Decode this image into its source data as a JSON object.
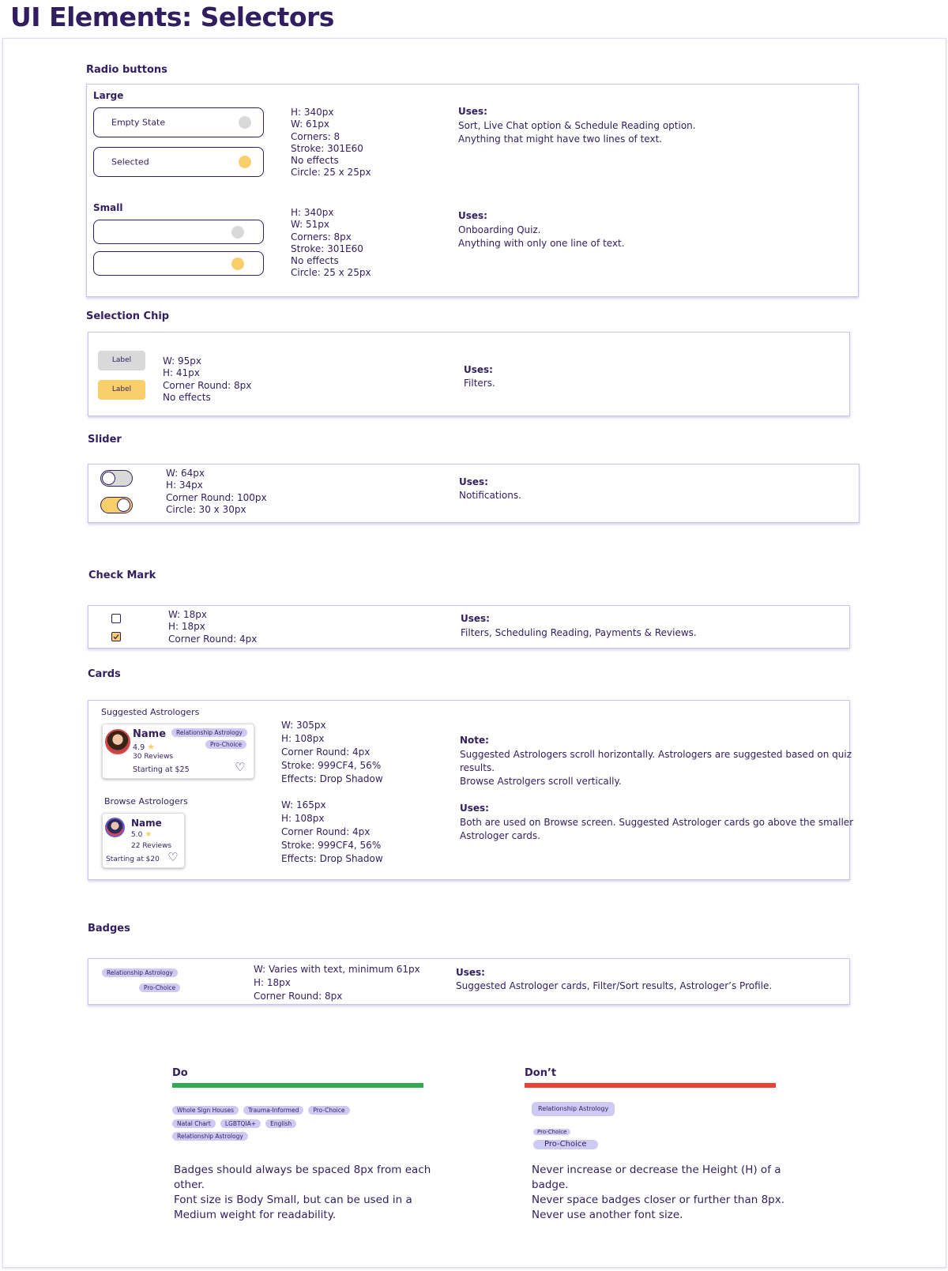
{
  "page": {
    "title": "UI Elements: Selectors"
  },
  "colors": {
    "primary": "#301E60",
    "accent": "#F9CF6B",
    "empty": "#D9D9D9",
    "stroke": "#999CF4",
    "badge": "#CFCAF4",
    "do": "#34A853",
    "dont": "#EA4335"
  },
  "radio": {
    "title": "Radio buttons",
    "large": {
      "label": "Large",
      "empty_label": "Empty State",
      "selected_label": "Selected",
      "specs": "H: 340px\nW: 61px\nCorners: 8\nStroke: 301E60\nNo effects\nCircle: 25 x 25px",
      "uses_title": "Uses:",
      "uses": "Sort, Live Chat option & Schedule Reading option.\nAnything that might have two lines of text."
    },
    "small": {
      "label": "Small",
      "specs": "H: 340px\nW: 51px\nCorners: 8px\nStroke: 301E60\nNo effects\nCircle: 25 x 25px",
      "uses_title": "Uses:",
      "uses": "Onboarding Quiz.\nAnything with only one line of text."
    }
  },
  "chip": {
    "title": "Selection Chip",
    "label": "Label",
    "specs": "W: 95px\nH: 41px\nCorner Round: 8px\nNo effects",
    "uses_title": "Uses:",
    "uses": "Filters."
  },
  "slider": {
    "title": "Slider",
    "specs": "W: 64px\nH: 34px\nCorner Round: 100px\nCircle: 30 x 30px",
    "uses_title": "Uses:",
    "uses": "Notifications."
  },
  "checkmark": {
    "title": "Check Mark",
    "specs": "W: 18px\nH: 18px\nCorner Round: 4px",
    "uses_title": "Uses:",
    "uses": "Filters, Scheduling Reading, Payments & Reviews."
  },
  "cards": {
    "title": "Cards",
    "suggested": {
      "label": "Suggested Astrologers",
      "name": "Name",
      "rating": "4.9",
      "reviews": "30 Reviews",
      "price": "Starting at $25",
      "badges": [
        "Relationship Astrology",
        "Pro-Choice"
      ],
      "specs": "W: 305px\nH: 108px\nCorner Round: 4px\nStroke: 999CF4, 56%\nEffects: Drop Shadow"
    },
    "browse": {
      "label": "Browse Astrologers",
      "name": "Name",
      "rating": "5.0",
      "reviews": "22 Reviews",
      "price": "Starting at $20",
      "specs": "W: 165px\nH: 108px\nCorner Round: 4px\nStroke: 999CF4, 56%\nEffects: Drop Shadow"
    },
    "note_title": "Note:",
    "note": "Suggested Astrologers scroll horizontally. Astrologers are suggested based on quiz\nresults.\nBrowse Astrolgers scroll vertically.",
    "uses_title": "Uses:",
    "uses": "Both are used on Browse screen. Suggested Astrologer cards go above the smaller\nAstrologer cards."
  },
  "badges": {
    "title": "Badges",
    "examples": [
      "Relationship Astrology",
      "Pro-Choice"
    ],
    "specs": "W: Varies with text, minimum 61px\nH: 18px\nCorner Round: 8px",
    "uses_title": "Uses:",
    "uses": "Suggested Astrologer cards, Filter/Sort results, Astrologer’s Profile."
  },
  "guidelines": {
    "do": {
      "title": "Do",
      "row1": [
        "Whole Sign Houses",
        "Trauma-Informed",
        "Pro-Choice"
      ],
      "row2": [
        "Natal Chart",
        "LGBTQIA+",
        "English"
      ],
      "row3": [
        "Relationship Astrology"
      ],
      "text": "Badges should always be spaced 8px from each\nother.\nFont size is Body Small, but can be used in a\nMedium weight for readability."
    },
    "dont": {
      "title": "Don’t",
      "big": "Relationship Astrology",
      "small": "Pro-Choice",
      "large_font": "Pro-Choice",
      "text": "Never increase or decrease the Height (H) of a\nbadge.\nNever space badges closer or further than 8px.\nNever use another font size."
    }
  }
}
